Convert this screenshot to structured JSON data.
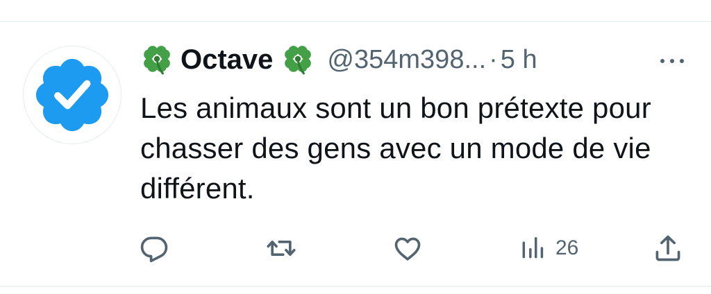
{
  "tweet": {
    "author": {
      "name": "Octave",
      "name_decoration": "🍀",
      "handle": "@354m398...",
      "verified": true
    },
    "separator": "·",
    "time": "5 h",
    "text": "Les animaux sont un bon prétexte pour chasser des gens avec un mode de vie différent.",
    "stats": {
      "views": "26"
    }
  },
  "icons": {
    "avatar": "verified-badge-icon",
    "decoration": "four-leaf-clover-icon",
    "more": "more-options-icon",
    "reply": "reply-icon",
    "retweet": "retweet-icon",
    "like": "like-icon",
    "views": "views-icon",
    "share": "share-icon"
  },
  "colors": {
    "verified_blue": "#1d9bf0",
    "text": "#0f1419",
    "secondary_text": "#536471",
    "clover_green": "#43a047"
  }
}
